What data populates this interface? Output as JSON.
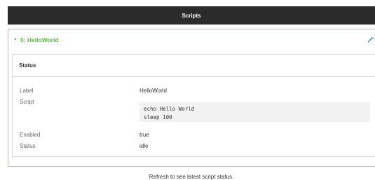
{
  "topbar": {
    "title": "Scripts"
  },
  "script": {
    "title": "0: HelloWorld",
    "accent_color": "#63b54f",
    "caret_icon": "triangle-down-icon",
    "edit_icon": "wrench-icon"
  },
  "status_card": {
    "title": "Status",
    "fields": {
      "label": {
        "name": "Label",
        "value": "HelloWorld"
      },
      "script": {
        "name": "Script",
        "lines": [
          "echo Hello World",
          "sleep 100"
        ]
      },
      "enabled": {
        "name": "Enabled",
        "value": "true"
      },
      "status": {
        "name": "Status",
        "value": "idle"
      }
    }
  },
  "footer": {
    "note": "Refresh to see latest script status."
  }
}
